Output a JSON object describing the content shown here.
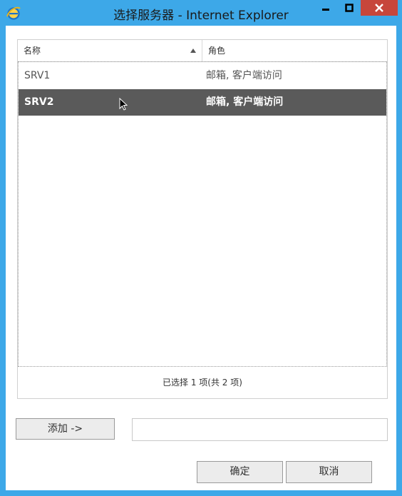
{
  "window": {
    "title": "选择服务器 - Internet Explorer",
    "icon": "ie-icon",
    "controls": {
      "minimize": "minimize-icon",
      "maximize": "maximize-icon",
      "close": "close-icon"
    },
    "colors": {
      "frame": "#3da8e8",
      "close": "#c7463b",
      "selected_row": "#5a5a5a"
    }
  },
  "list": {
    "columns": [
      {
        "label": "名称",
        "sort": "ascending"
      },
      {
        "label": "角色"
      }
    ],
    "rows": [
      {
        "name": "SRV1",
        "role": "邮箱, 客户端访问",
        "selected": false
      },
      {
        "name": "SRV2",
        "role": "邮箱, 客户端访问",
        "selected": true
      }
    ],
    "status": "已选择 1 项(共 2 项)"
  },
  "add": {
    "button_label": "添加 ->",
    "field_value": ""
  },
  "footer": {
    "ok_label": "确定",
    "cancel_label": "取消"
  }
}
